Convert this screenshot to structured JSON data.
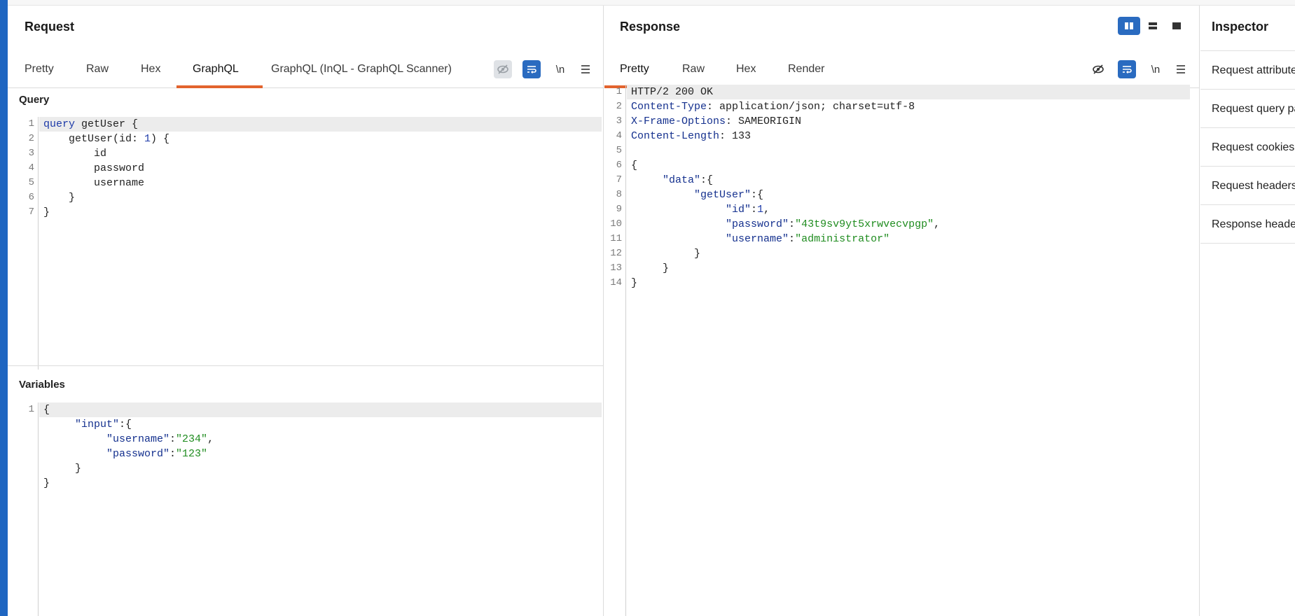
{
  "request": {
    "title": "Request",
    "tabs": [
      "Pretty",
      "Raw",
      "Hex",
      "GraphQL",
      "GraphQL (InQL - GraphQL Scanner)"
    ],
    "active_tab": "GraphQL",
    "newline_label": "\\n",
    "query_label": "Query",
    "variables_label": "Variables",
    "query_lines": [
      [
        [
          "kw",
          "query"
        ],
        [
          "plain",
          " getUser {"
        ]
      ],
      [
        [
          "plain",
          "    getUser(id: "
        ],
        [
          "num",
          "1"
        ],
        [
          "plain",
          ") {"
        ]
      ],
      [
        [
          "plain",
          "        id"
        ]
      ],
      [
        [
          "plain",
          "        password"
        ]
      ],
      [
        [
          "plain",
          "        username"
        ]
      ],
      [
        [
          "plain",
          "    }"
        ]
      ],
      [
        [
          "plain",
          "}"
        ]
      ]
    ],
    "variables_lines": [
      [
        [
          "plain",
          "{"
        ]
      ],
      [
        [
          "plain",
          "     "
        ],
        [
          "key",
          "\"input\""
        ],
        [
          "plain",
          ":{"
        ]
      ],
      [
        [
          "plain",
          "          "
        ],
        [
          "key",
          "\"username\""
        ],
        [
          "plain",
          ":"
        ],
        [
          "str",
          "\"234\""
        ],
        [
          "plain",
          ","
        ]
      ],
      [
        [
          "plain",
          "          "
        ],
        [
          "key",
          "\"password\""
        ],
        [
          "plain",
          ":"
        ],
        [
          "str",
          "\"123\""
        ]
      ],
      [
        [
          "plain",
          "     }"
        ]
      ],
      [
        [
          "plain",
          "}"
        ]
      ]
    ],
    "variables_line_numbers": [
      "1"
    ]
  },
  "response": {
    "title": "Response",
    "tabs": [
      "Pretty",
      "Raw",
      "Hex",
      "Render"
    ],
    "active_tab": "Pretty",
    "newline_label": "\\n",
    "lines": [
      [
        [
          "plain",
          "HTTP/2 200 OK"
        ]
      ],
      [
        [
          "key",
          "Content-Type"
        ],
        [
          "plain",
          ": application/json; charset=utf-8"
        ]
      ],
      [
        [
          "key",
          "X-Frame-Options"
        ],
        [
          "plain",
          ": SAMEORIGIN"
        ]
      ],
      [
        [
          "key",
          "Content-Length"
        ],
        [
          "plain",
          ": 133"
        ]
      ],
      [
        [
          "plain",
          ""
        ]
      ],
      [
        [
          "plain",
          "{"
        ]
      ],
      [
        [
          "plain",
          "     "
        ],
        [
          "key",
          "\"data\""
        ],
        [
          "plain",
          ":{"
        ]
      ],
      [
        [
          "plain",
          "          "
        ],
        [
          "key",
          "\"getUser\""
        ],
        [
          "plain",
          ":{"
        ]
      ],
      [
        [
          "plain",
          "               "
        ],
        [
          "key",
          "\"id\""
        ],
        [
          "plain",
          ":"
        ],
        [
          "num",
          "1"
        ],
        [
          "plain",
          ","
        ]
      ],
      [
        [
          "plain",
          "               "
        ],
        [
          "key",
          "\"password\""
        ],
        [
          "plain",
          ":"
        ],
        [
          "str",
          "\"43t9sv9yt5xrwvecvpgp\""
        ],
        [
          "plain",
          ","
        ]
      ],
      [
        [
          "plain",
          "               "
        ],
        [
          "key",
          "\"username\""
        ],
        [
          "plain",
          ":"
        ],
        [
          "str",
          "\"administrator\""
        ]
      ],
      [
        [
          "plain",
          "          }"
        ]
      ],
      [
        [
          "plain",
          "     }"
        ]
      ],
      [
        [
          "plain",
          "}"
        ]
      ]
    ]
  },
  "inspector": {
    "title": "Inspector",
    "items": [
      "Request attributes",
      "Request query parameters",
      "Request cookies",
      "Request headers",
      "Response headers"
    ]
  },
  "colors": {
    "accent_tab": "#e2632e",
    "accent_blue": "#2a6bc0",
    "side_strip": "#1f66c1"
  }
}
